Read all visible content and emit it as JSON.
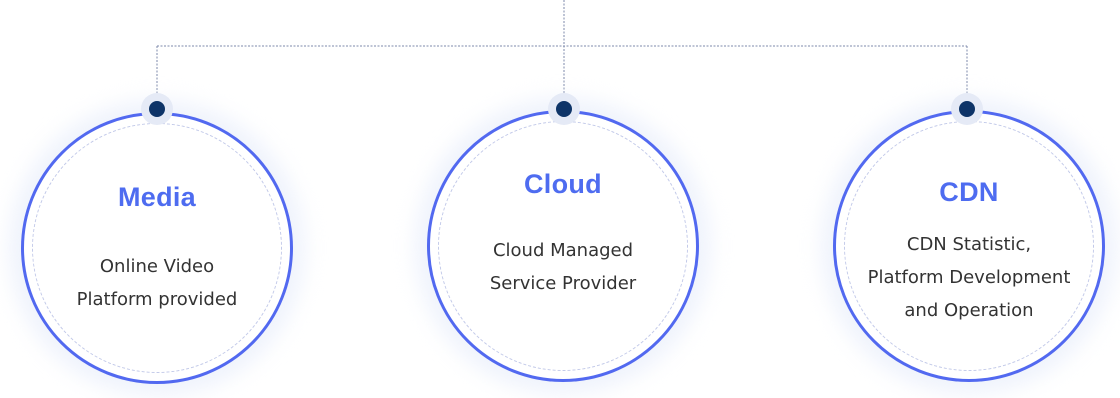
{
  "colors": {
    "accent": "#4e6cf0",
    "ring": "#5269f0",
    "connector_dot": "#0e3468",
    "body_text": "#333333"
  },
  "nodes": [
    {
      "title": "Media",
      "description": "Online Video\nPlatform provided"
    },
    {
      "title": "Cloud",
      "description": "Cloud Managed\nService Provider"
    },
    {
      "title": "CDN",
      "description": "CDN Statistic,\nPlatform Development\nand Operation"
    }
  ]
}
